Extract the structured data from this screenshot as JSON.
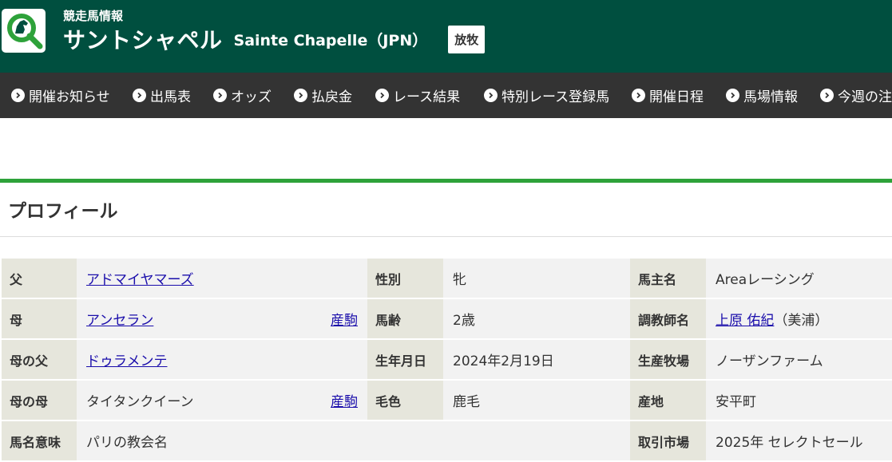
{
  "header": {
    "subtitle": "競走馬情報",
    "name_ja": "サントシャペル",
    "name_en": "Sainte Chapelle（JPN）",
    "status": "放牧",
    "logo_icon": "search-horse-logo-icon"
  },
  "nav": {
    "items": [
      {
        "label": "開催お知らせ"
      },
      {
        "label": "出馬表"
      },
      {
        "label": "オッズ"
      },
      {
        "label": "払戻金"
      },
      {
        "label": "レース結果"
      },
      {
        "label": "特別レース登録馬"
      },
      {
        "label": "開催日程"
      },
      {
        "label": "馬場情報"
      },
      {
        "label": "今週の注"
      }
    ]
  },
  "section": {
    "title": "プロフィール"
  },
  "profile": {
    "sire_label": "父",
    "sire": "アドマイヤマーズ",
    "sex_label": "性別",
    "sex": "牝",
    "owner_label": "馬主名",
    "owner": "Areaレーシング",
    "dam_label": "母",
    "dam": "アンセラン",
    "dam_produce": "産駒",
    "age_label": "馬齢",
    "age": "2歳",
    "trainer_label": "調教師名",
    "trainer": "上原 佑紀",
    "trainer_affil": "（美浦）",
    "damsire_label": "母の父",
    "damsire": "ドゥラメンテ",
    "birth_label": "生年月日",
    "birth": "2024年2月19日",
    "breeder_label": "生産牧場",
    "breeder": "ノーザンファーム",
    "granddam_label": "母の母",
    "granddam": "タイタンクイーン",
    "granddam_produce": "産駒",
    "color_label": "毛色",
    "color": "鹿毛",
    "origin_label": "産地",
    "origin": "安平町",
    "meaning_label": "馬名意味",
    "meaning": "パリの教会名",
    "market_label": "取引市場",
    "market": "2025年 セレクトセール"
  },
  "colors": {
    "header_bg": "#004f3f",
    "nav_bg": "#333333",
    "accent_green": "#2ea23a",
    "label_cell_bg": "#e6e6dc",
    "value_cell_bg": "#f2f2f2",
    "link": "#1a0dab"
  }
}
